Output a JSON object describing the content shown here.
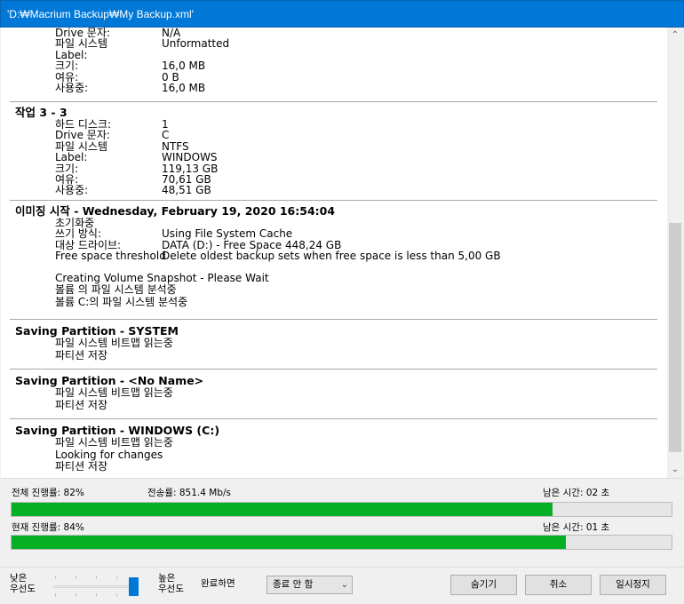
{
  "window": {
    "title": "'D:₩Macrium Backup₩My Backup.xml'"
  },
  "log": {
    "top_partial": [
      {
        "k": "Drive 문자:",
        "v": "N/A"
      },
      {
        "k": "파일 시스템",
        "v": "Unformatted"
      },
      {
        "k": "Label:",
        "v": ""
      },
      {
        "k": "크기:",
        "v": "16,0 MB"
      },
      {
        "k": "여유:",
        "v": "0 B"
      },
      {
        "k": "사용중:",
        "v": "16,0 MB"
      }
    ],
    "task3": {
      "title": "작업 3 - 3",
      "rows": [
        {
          "k": "하드 디스크:",
          "v": "1"
        },
        {
          "k": "Drive 문자:",
          "v": "C"
        },
        {
          "k": "파일 시스템",
          "v": "NTFS"
        },
        {
          "k": "Label:",
          "v": "WINDOWS"
        },
        {
          "k": "크기:",
          "v": "119,13 GB"
        },
        {
          "k": "여유:",
          "v": "70,61 GB"
        },
        {
          "k": "사용중:",
          "v": "48,51 GB"
        }
      ]
    },
    "imaging": {
      "title": "이미징 시작 - Wednesday, February 19, 2020 16:54:04",
      "rows": [
        {
          "k": "초기화중",
          "v": ""
        },
        {
          "k": "쓰기 방식:",
          "v": "Using File System Cache"
        },
        {
          "k": "대상 드라이브:",
          "v": "DATA (D:) - Free Space 448,24 GB"
        },
        {
          "k": "Free space threshold",
          "v": "Delete oldest backup sets when free space is less than 5,00 GB"
        }
      ],
      "lines": [
        "Creating Volume Snapshot - Please Wait",
        "볼륨 의 파일 시스템 분석중",
        "볼륨 C:의 파일 시스템 분석중"
      ]
    },
    "partitions": [
      {
        "title": "Saving Partition - SYSTEM",
        "lines": [
          "파일 시스템 비트맵 읽는중",
          "파티션 저장"
        ]
      },
      {
        "title": "Saving Partition - <No Name>",
        "lines": [
          "파일 시스템 비트맵 읽는중",
          "파티션 저장"
        ]
      },
      {
        "title": "Saving Partition - WINDOWS (C:)",
        "lines": [
          "파일 시스템 비트맵 읽는중",
          "Looking for changes",
          "파티션 저장"
        ]
      }
    ]
  },
  "progress": {
    "overall_label": "전체 진행률:",
    "overall_value": "82%",
    "overall_fraction": 0.82,
    "transfer_label": "전송률:",
    "transfer_value": "851.4 Mb/s",
    "remaining1_label": "남은 시간:",
    "remaining1_value": "02 초",
    "current_label": "현재 진행률:",
    "current_value": "84%",
    "current_fraction": 0.84,
    "remaining2_label": "남은 시간:",
    "remaining2_value": "01 초"
  },
  "footer": {
    "low_priority_1": "낮은",
    "low_priority_2": "우선도",
    "high_priority_1": "높은",
    "high_priority_2": "우선도",
    "on_complete_label": "완료하면",
    "on_complete_value": "종료 안 함",
    "hide_button": "숨기기",
    "cancel_button": "취소",
    "pause_button": "일시정지"
  },
  "colors": {
    "titlebar": "#0078d7",
    "progress_fill": "#06b025"
  }
}
